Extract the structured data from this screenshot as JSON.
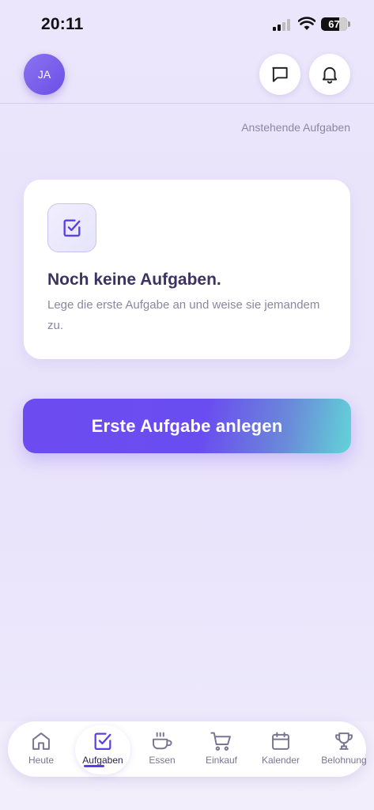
{
  "status": {
    "time": "20:11",
    "battery": "67"
  },
  "header": {
    "avatar_initials": "JA",
    "chat_icon": "chat-icon",
    "bell_icon": "bell-icon"
  },
  "subtitle": "Anstehende Aufgaben",
  "empty_state": {
    "icon": "checkbox-icon",
    "title": "Noch keine Aufgaben.",
    "text": "Lege die erste Aufgabe an und weise sie jemandem zu."
  },
  "cta_label": "Erste Aufgabe anlegen",
  "nav": {
    "items": [
      {
        "label": "Heute",
        "icon": "home-icon"
      },
      {
        "label": "Aufgaben",
        "icon": "checkbox-icon",
        "active": true
      },
      {
        "label": "Essen",
        "icon": "cup-icon"
      },
      {
        "label": "Einkauf",
        "icon": "cart-icon"
      },
      {
        "label": "Kalender",
        "icon": "calendar-icon"
      },
      {
        "label": "Belohnung",
        "icon": "trophy-icon"
      }
    ]
  },
  "colors": {
    "accent": "#6c4cf0",
    "accent_end": "#62d4d8",
    "background": "#ebe6fb"
  }
}
